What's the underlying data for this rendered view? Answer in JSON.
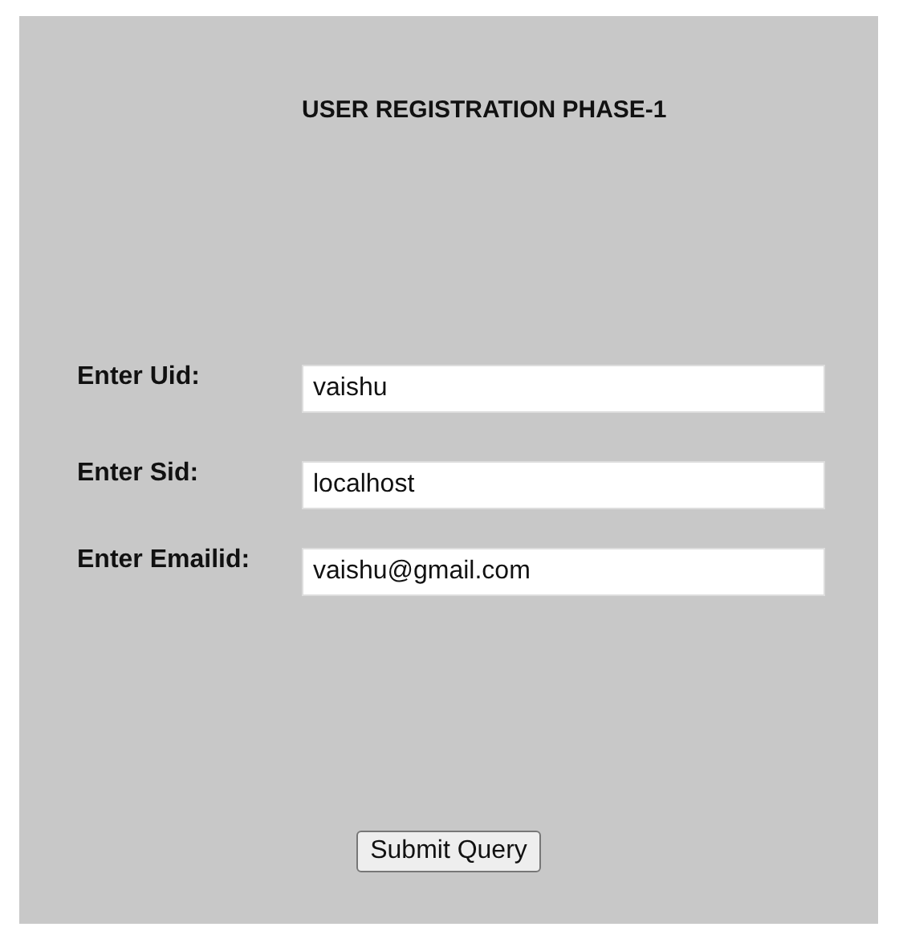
{
  "title": "USER REGISTRATION PHASE-1",
  "fields": [
    {
      "label": "Enter Uid:",
      "value": "vaishu"
    },
    {
      "label": "Enter Sid:",
      "value": "localhost"
    },
    {
      "label": "Enter Emailid:",
      "value": "vaishu@gmail.com"
    }
  ],
  "submit_button": "Submit Query"
}
